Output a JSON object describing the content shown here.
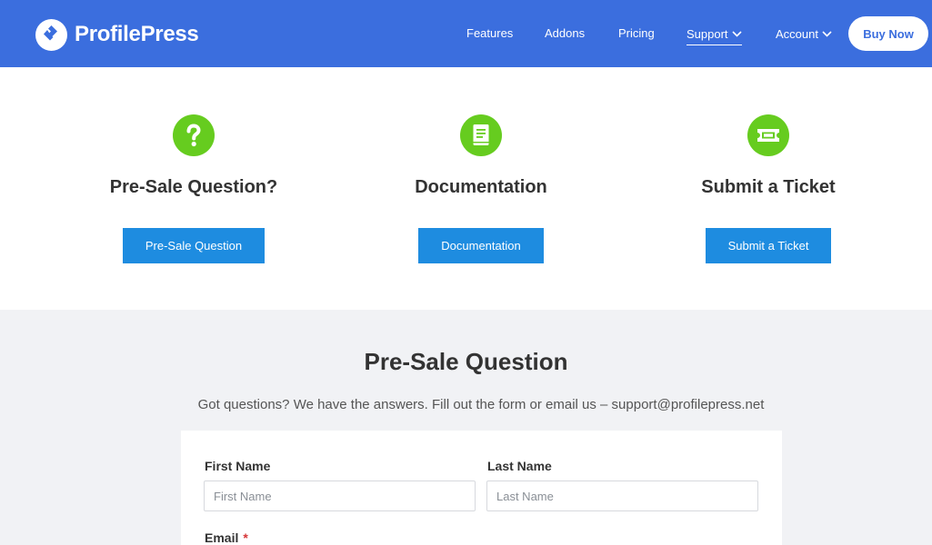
{
  "brand": {
    "name": "ProfilePress"
  },
  "nav": {
    "items": [
      {
        "label": "Features"
      },
      {
        "label": "Addons"
      },
      {
        "label": "Pricing"
      },
      {
        "label": "Support"
      },
      {
        "label": "Account"
      }
    ],
    "buy_label": "Buy Now"
  },
  "cards": [
    {
      "icon": "question-icon",
      "title": "Pre-Sale Question?",
      "button": "Pre-Sale Question"
    },
    {
      "icon": "book-icon",
      "title": "Documentation",
      "button": "Documentation"
    },
    {
      "icon": "ticket-icon",
      "title": "Submit a Ticket",
      "button": "Submit a Ticket"
    }
  ],
  "form": {
    "title": "Pre-Sale Question",
    "subtitle": "Got questions? We have the answers. Fill out the form or email us – support@profilepress.net",
    "first_name": {
      "label": "First Name",
      "placeholder": "First Name"
    },
    "last_name": {
      "label": "Last Name",
      "placeholder": "Last Name"
    },
    "email": {
      "label": "Email",
      "required_mark": "*"
    }
  },
  "colors": {
    "nav_bg": "#3b6ede",
    "accent_green": "#66cc1f",
    "button_blue": "#1e8ce0",
    "section_bg": "#f1f2f5"
  }
}
